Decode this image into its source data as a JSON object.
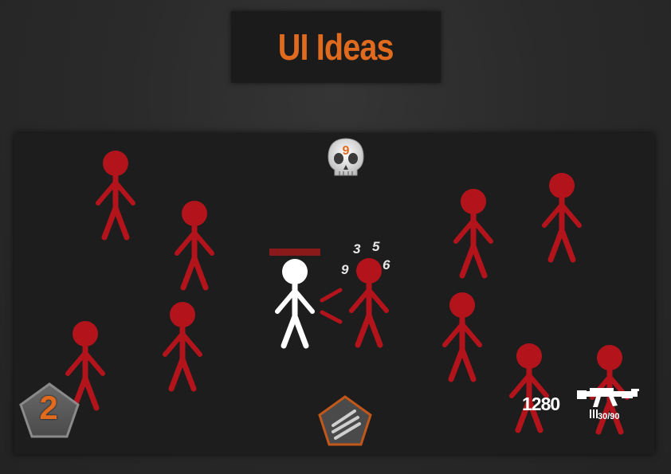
{
  "title": "UI Ideas",
  "hud": {
    "score": "1280",
    "ammo": "30/90",
    "wave": "2",
    "kill_count": "9",
    "player_health": 1.0
  },
  "damage_numbers": [
    "3",
    "5",
    "9",
    "6"
  ],
  "colors": {
    "accent": "#e06a1e",
    "enemy": "#b3141c",
    "player": "#ffffff",
    "health_bar": "#8a1a1a"
  },
  "icons": {
    "kill_counter": "skull-icon",
    "weapon": "assault-rifle-icon",
    "ammo": "bullets-icon",
    "ability": "claw-slash-icon",
    "wave_badge": "pentagon-badge-icon"
  }
}
